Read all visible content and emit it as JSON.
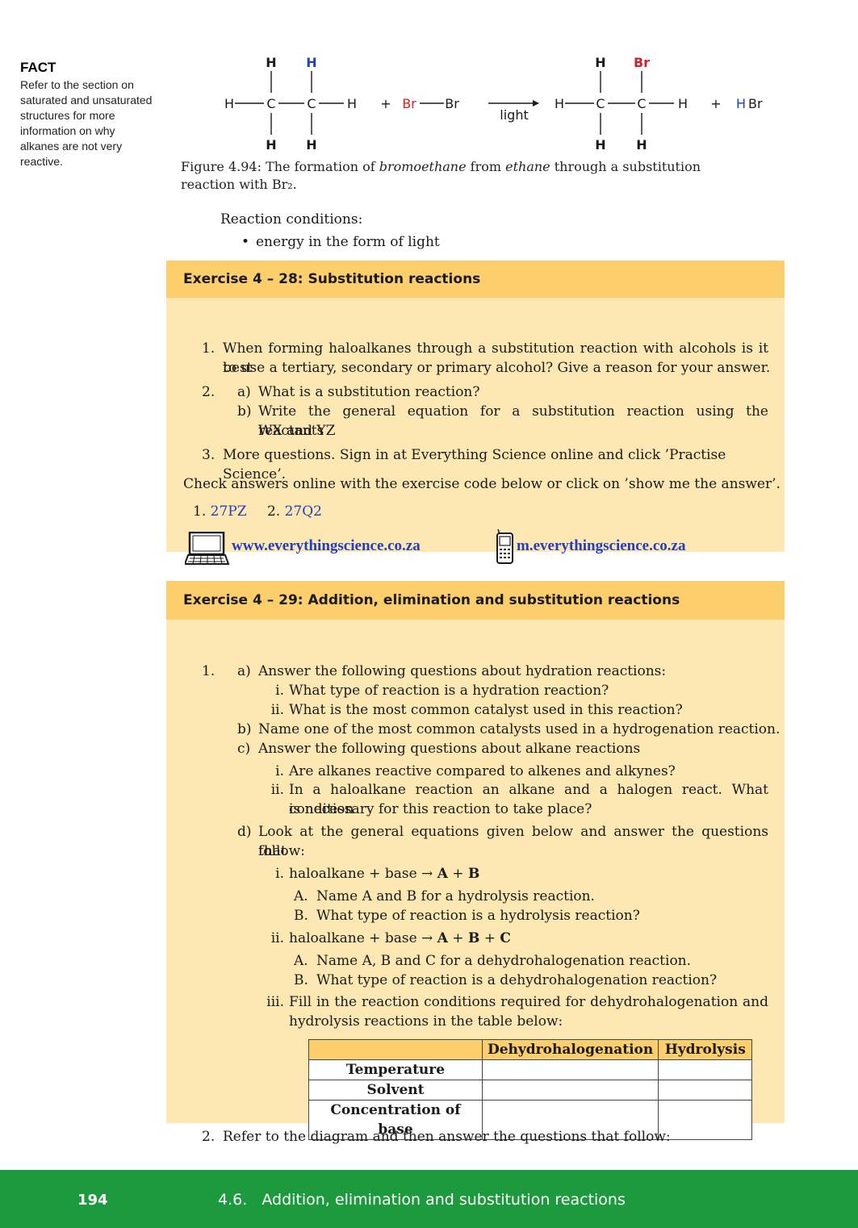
{
  "sidebar": {
    "title": "FACT",
    "text": "Refer to the section on saturated and unsaturated structures for more information on why alkanes are not very reactive."
  },
  "equation": {
    "h": "H",
    "c": "C",
    "br": "Br",
    "plus": "+",
    "light": "light",
    "hbr_h": "H",
    "hbr_br": "Br",
    "colors": {
      "red": "#d0222a",
      "blue": "#1f3fc4",
      "black": "#1a1a1a"
    }
  },
  "figure": {
    "prefix": "Figure 4.94: The formation of ",
    "product": "bromoethane",
    "mid": " from ",
    "reactant": "ethane",
    "suffix": " through a substitution reaction with Br₂."
  },
  "conditions": {
    "label": "Reaction conditions:",
    "items": [
      "energy in the form of light"
    ]
  },
  "exercise28": {
    "title": "Exercise 4 – 28: Substitution reactions",
    "q1_num": "1.",
    "q1_line1": "When forming haloalkanes through a substitution reaction with alcohols is it best",
    "q1_line2": "to use a tertiary, secondary or primary alcohol? Give a reason for your answer.",
    "q2_num": "2.",
    "q2a_label": "a)",
    "q2a_text": "What is a substitution reaction?",
    "q2b_label": "b)",
    "q2b_line1": "Write the general equation for a substitution reaction using the reactants",
    "q2b_line2": "WX and YZ",
    "q3_num": "3.",
    "q3_text": "More questions. Sign in at Everything Science online and click ’Practise Science’.",
    "check": "Check answers online with the exercise code below or click on ’show me the answer’.",
    "codes": [
      {
        "num": "1.",
        "code": "27PZ"
      },
      {
        "num": "2.",
        "code": "27Q2"
      }
    ],
    "web": "www.everythingscience.co.za",
    "mobile": "m.everythingscience.co.za"
  },
  "exercise29": {
    "title": "Exercise 4 – 29: Addition, elimination and substitution reactions",
    "q1_num": "1.",
    "a_label": "a)",
    "a_text": "Answer the following questions about hydration reactions:",
    "a_i_label": "i.",
    "a_i": "What type of reaction is a hydration reaction?",
    "a_ii_label": "ii.",
    "a_ii": "What is the most common catalyst used in this reaction?",
    "b_label": "b)",
    "b_text": "Name one of the most common catalysts used in a hydrogenation reaction.",
    "c_label": "c)",
    "c_text": "Answer the following questions about alkane reactions",
    "c_i_label": "i.",
    "c_i": "Are alkanes reactive compared to alkenes and alkynes?",
    "c_ii_label": "ii.",
    "c_ii_line1": "In a haloalkane reaction an alkane and a halogen react. What condition",
    "c_ii_line2": "is necessary for this reaction to take place?",
    "d_label": "d)",
    "d_line1": "Look at the general equations given below and answer the questions that",
    "d_line2": "follow:",
    "d_i_label": "i.",
    "d_i_eq": "haloalkane + base → ",
    "d_i_A": "A",
    "d_i_plus": " + ",
    "d_i_B": "B",
    "d_i_A_label": "A.",
    "d_i_A_text": "Name A and B for a hydrolysis reaction.",
    "d_i_B_label": "B.",
    "d_i_B_text": "What type of reaction is a hydrolysis reaction?",
    "d_ii_label": "ii.",
    "d_ii_eq": "haloalkane + base → ",
    "d_ii_A": "A",
    "d_ii_plus1": " + ",
    "d_ii_B": "B",
    "d_ii_plus2": " + ",
    "d_ii_C": "C",
    "d_ii_A_label": "A.",
    "d_ii_A_text": "Name A, B and C for a dehydrohalogenation reaction.",
    "d_ii_B_label": "B.",
    "d_ii_B_text": "What type of reaction is a dehydrohalogenation reaction?",
    "d_iii_label": "iii.",
    "d_iii_line1": "Fill in the reaction conditions required for dehydrohalogenation and",
    "d_iii_line2": "hydrolysis reactions in the table below:",
    "table": {
      "headers": [
        "",
        "Dehydrohalogenation",
        "Hydrolysis"
      ],
      "rows": [
        "Temperature",
        "Solvent",
        "Concentration of base"
      ]
    },
    "q2_num": "2.",
    "q2_text": "Refer to the diagram and then answer the questions that follow:"
  },
  "footer": {
    "page": "194",
    "section": "4.6.   Addition, elimination and substitution reactions"
  }
}
